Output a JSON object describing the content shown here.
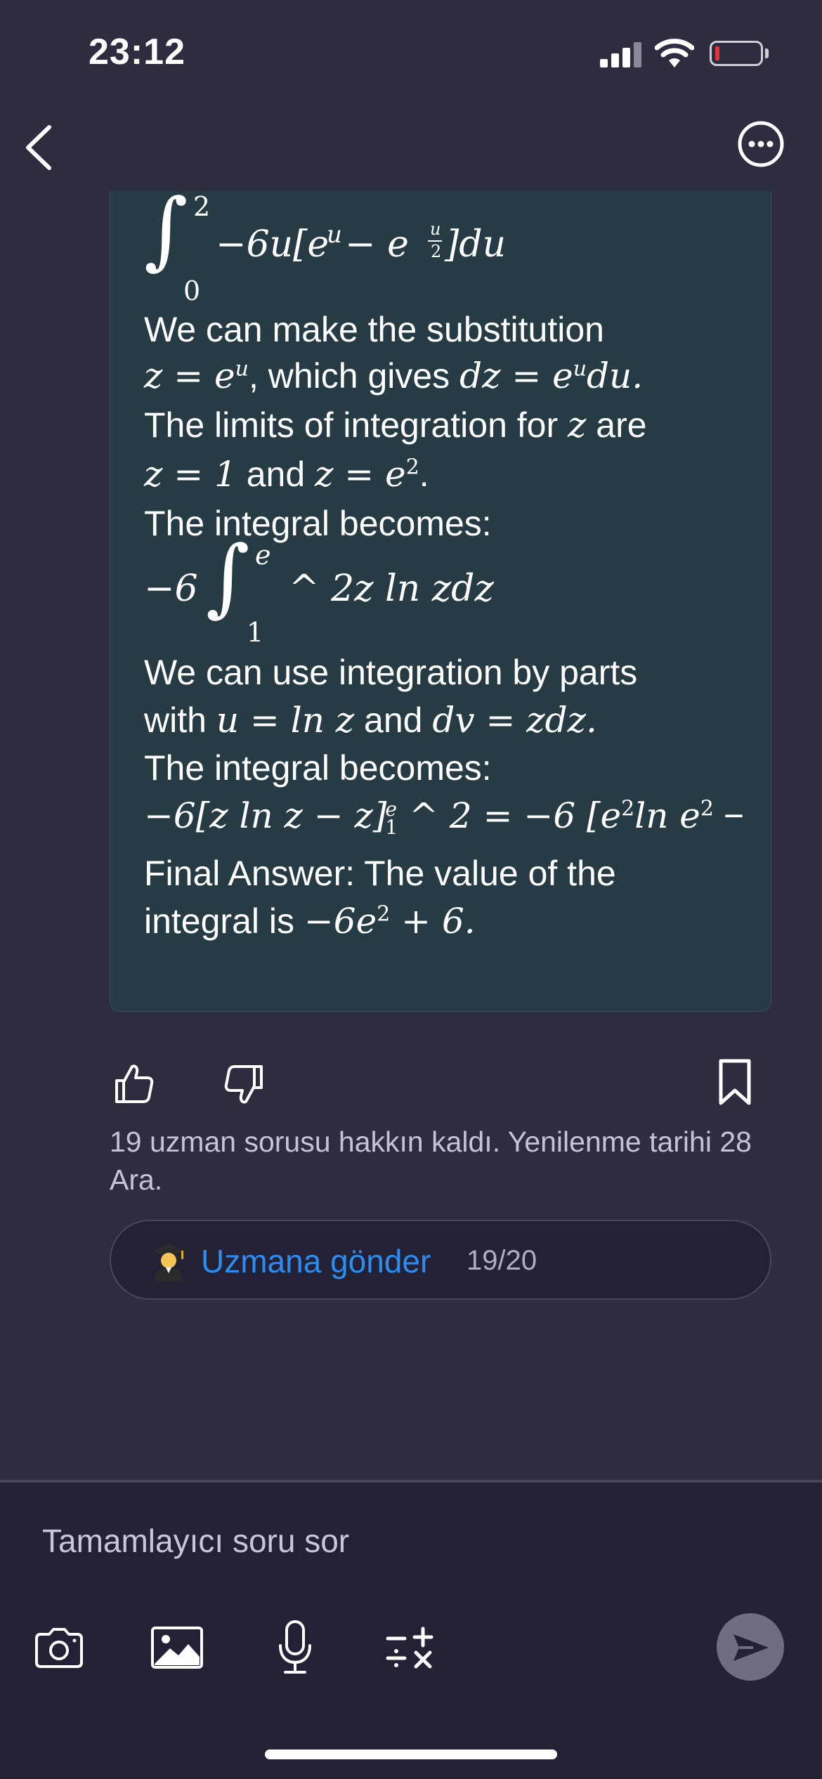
{
  "status_bar": {
    "time": "23:12"
  },
  "card": {
    "integral_top": {
      "upper": "2",
      "lower": "0",
      "body": "−6u[e",
      "exp_u": "u",
      "minus_e": " − e",
      "frac_num": "u",
      "frac_den": "2",
      "close": "]du"
    },
    "p1": "We can make the substitution",
    "p2_math_a": "z = e",
    "p2_exp": "u",
    "p2_text": ", which gives ",
    "p2_math_b": "dz = e",
    "p2_exp2": "u",
    "p2_math_c": "du.",
    "p3_text": "The limits of integration for ",
    "p3_var": "z",
    "p3_text2": " are",
    "p4_math_a": "z = 1",
    "p4_text": " and ",
    "p4_math_b": "z = e",
    "p4_exp": "2",
    "p4_dot": ".",
    "p5": "The integral becomes:",
    "integral2": {
      "coef": "−6",
      "upper": "e",
      "lower": "1",
      "body": "^ 2z ln zdz"
    },
    "p6": "We can use integration by parts",
    "p7_text": "with ",
    "p7_math_a": "u = ln z",
    "p7_text2": " and ",
    "p7_math_b": "dv = zdz.",
    "p8": "The integral becomes:",
    "p9": {
      "a": "−6[z ln z − z]",
      "sup": "e",
      "sub": "1",
      "b": " ^ 2 = −6 [e",
      "sup2": "2",
      "c": "ln e",
      "sup3": "2",
      "d": " −"
    },
    "p10": "Final Answer: The value of the",
    "p11_text": "integral is ",
    "p11_math": "−6e",
    "p11_exp": "2",
    "p11_math2": " + 6."
  },
  "icons": [
    "thumbs-up-icon",
    "thumbs-down-icon",
    "bookmark-icon",
    "camera-icon",
    "image-icon",
    "microphone-icon",
    "math-operators-icon",
    "send-icon"
  ],
  "quota_text": "19 uzman sorusu hakkın kaldı. Yenilenme tarihi 28 Ara.",
  "expert_button": {
    "label": "Uzmana gönder",
    "count": "19/20"
  },
  "input": {
    "placeholder": "Tamamlayıcı soru sor"
  },
  "colors": {
    "background": "#2e2c3f",
    "card": "#263b43",
    "accent": "#2d8cf0",
    "bottom_bar": "#232136"
  }
}
